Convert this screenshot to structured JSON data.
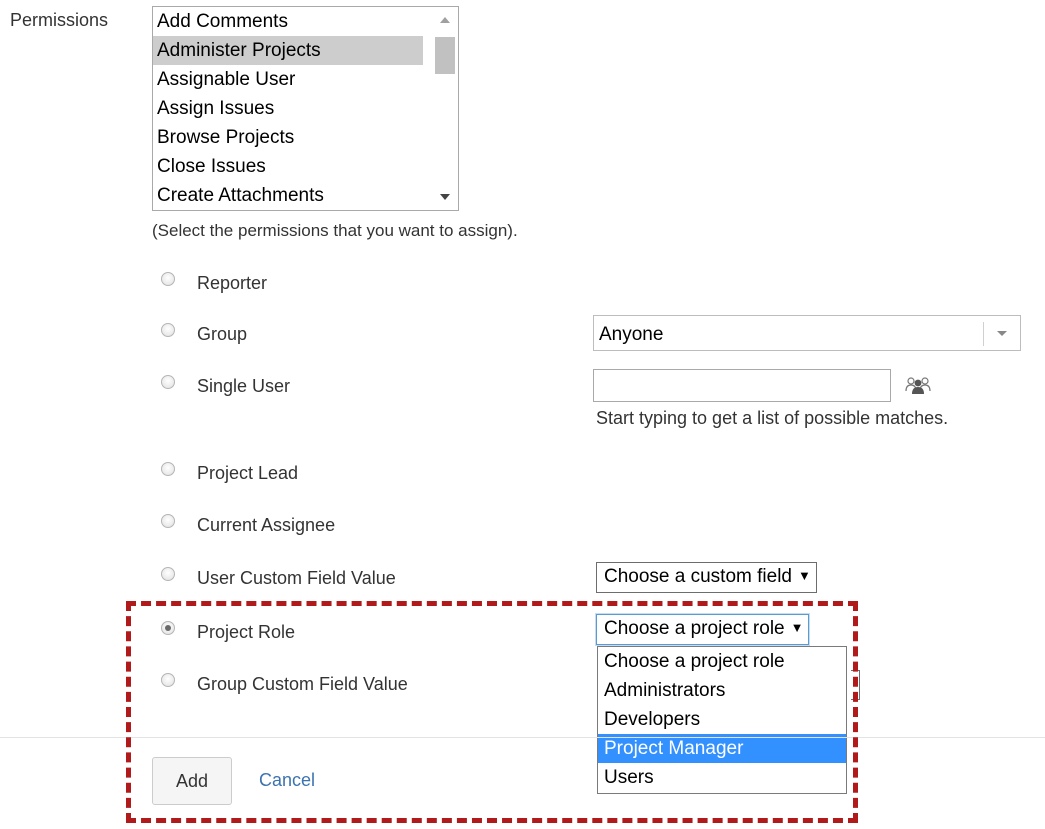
{
  "permissions": {
    "label": "Permissions",
    "items": [
      "Add Comments",
      "Administer Projects",
      "Assignable User",
      "Assign Issues",
      "Browse Projects",
      "Close Issues",
      "Create Attachments"
    ],
    "selected": "Administer Projects",
    "hint": "(Select the permissions that you want to assign)."
  },
  "options": {
    "reporter": "Reporter",
    "group": "Group",
    "single_user": "Single User",
    "project_lead": "Project Lead",
    "current_assignee": "Current Assignee",
    "user_custom_field": "User Custom Field Value",
    "project_role": "Project Role",
    "group_custom_field": "Group Custom Field Value"
  },
  "group_select": {
    "value": "Anyone"
  },
  "single_user": {
    "value": "",
    "hint": "Start typing to get a list of possible matches."
  },
  "custom_field_select": {
    "value": "Choose a custom field",
    "arrow": "▼"
  },
  "project_role_select": {
    "value": "Choose a project role",
    "arrow": "▼",
    "options": [
      "Choose a project role",
      "Administrators",
      "Developers",
      "Project Manager",
      "Users"
    ],
    "highlighted": "Project Manager"
  },
  "actions": {
    "add": "Add",
    "cancel": "Cancel"
  },
  "colors": {
    "link": "#3b73af",
    "highlight_option": "#3390ff",
    "annotation_border": "#b01a1a"
  }
}
